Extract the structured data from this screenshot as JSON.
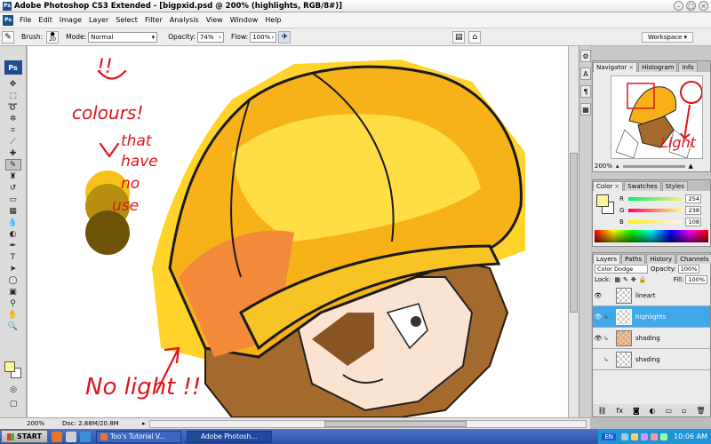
{
  "window": {
    "title": "Adobe Photoshop CS3 Extended - [bigpxid.psd @ 200% (highlights, RGB/8#)]"
  },
  "menu": [
    "File",
    "Edit",
    "Image",
    "Layer",
    "Select",
    "Filter",
    "Analysis",
    "View",
    "Window",
    "Help"
  ],
  "options": {
    "brush_label": "Brush:",
    "brush_size": "20",
    "mode_label": "Mode:",
    "mode_value": "Normal",
    "opacity_label": "Opacity:",
    "opacity_value": "74%",
    "flow_label": "Flow:",
    "flow_value": "100%",
    "workspace_label": "Workspace ▾"
  },
  "tools": {
    "logo": "Ps",
    "items": [
      "move",
      "marquee",
      "lasso",
      "quick-select",
      "crop",
      "slice",
      "healing",
      "brush",
      "stamp",
      "history-brush",
      "eraser",
      "gradient",
      "blur",
      "dodge",
      "pen",
      "type",
      "path-select",
      "shape",
      "notes",
      "eyedropper",
      "hand",
      "zoom"
    ],
    "active_index": 7,
    "fg_color": "#fdf599"
  },
  "canvas": {
    "annotations": {
      "exclaim": "!!",
      "colours": "colours!",
      "that": "that",
      "have": "have",
      "no": "no",
      "use": "use",
      "nolight": "No light !!"
    },
    "swatches": [
      "#f6c21a",
      "#b58e12",
      "#6e5208"
    ]
  },
  "status": {
    "zoom": "200%",
    "doc": "Doc: 2.88M/20.8M"
  },
  "navigator": {
    "tabs": [
      "Navigator",
      "Histogram",
      "Info"
    ],
    "zoom": "200%",
    "annotation": "Light"
  },
  "color": {
    "tabs": [
      "Color",
      "Swatches",
      "Styles"
    ],
    "r": {
      "label": "R",
      "value": "254"
    },
    "g": {
      "label": "G",
      "value": "238"
    },
    "b": {
      "label": "B",
      "value": "108"
    },
    "fg": "#fdf599"
  },
  "layers": {
    "tabs": [
      "Layers",
      "Paths",
      "History",
      "Channels"
    ],
    "blend_mode": "Color Dodge",
    "opacity_label": "Opacity:",
    "opacity_value": "100%",
    "lock_label": "Lock:",
    "fill_label": "Fill:",
    "fill_value": "100%",
    "items": [
      {
        "name": "lineart",
        "visible": true,
        "active": false
      },
      {
        "name": "highlights",
        "visible": true,
        "active": true
      },
      {
        "name": "shading",
        "visible": true,
        "active": false
      },
      {
        "name": "shading",
        "visible": false,
        "active": false
      }
    ]
  },
  "taskbar": {
    "start": "START",
    "tasks": [
      "Too's Tutorial V...",
      "Adobe Photosh..."
    ],
    "lang": "EN",
    "clock": "10:06 AM"
  }
}
